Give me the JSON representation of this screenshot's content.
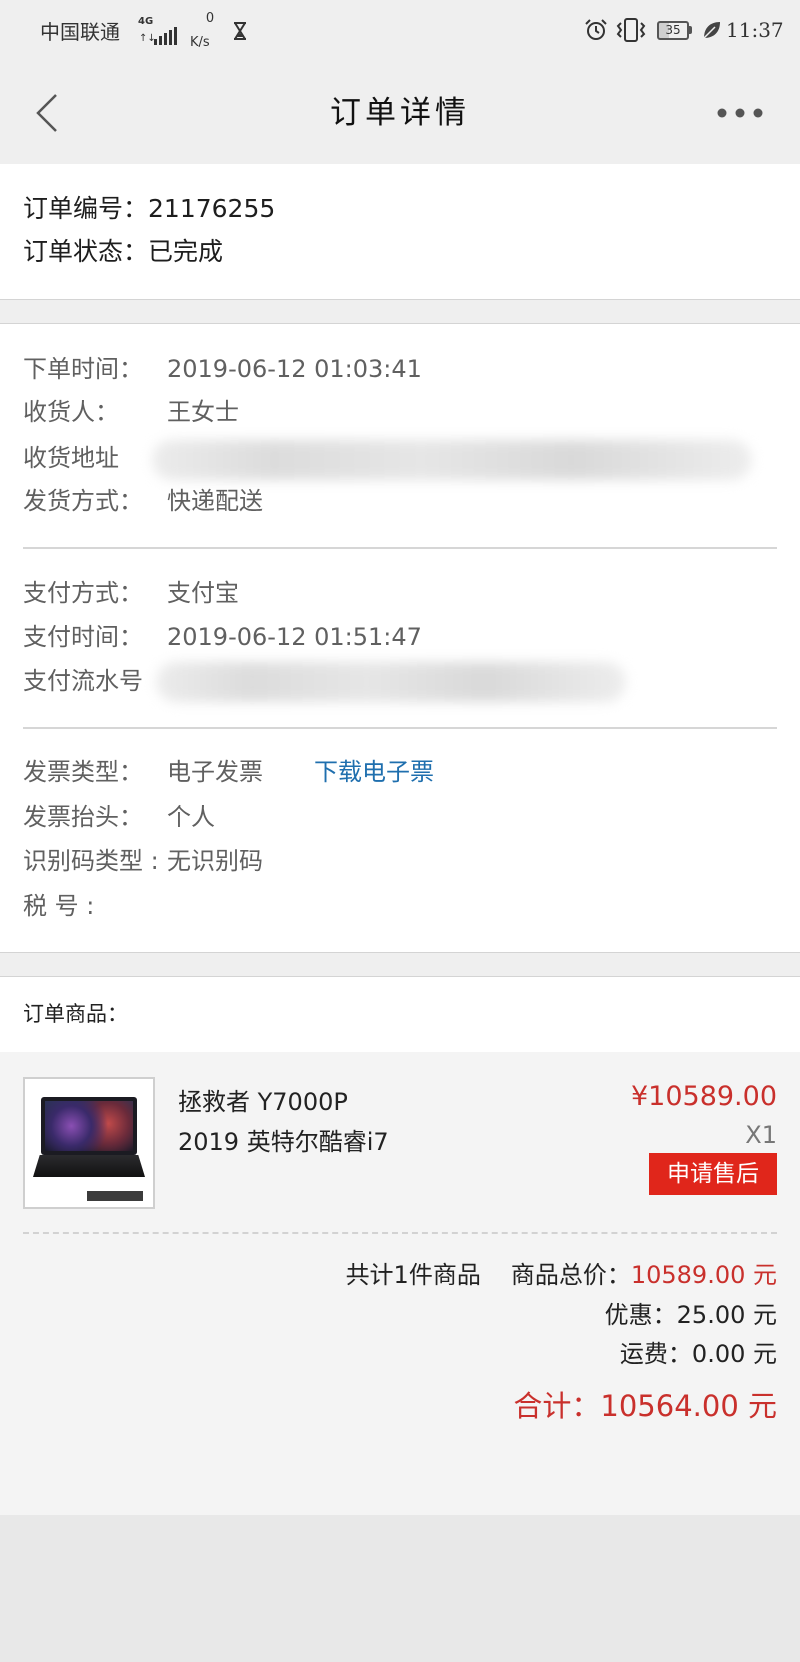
{
  "status_bar": {
    "carrier": "中国联通",
    "network": "4G",
    "speed_value": "0",
    "speed_unit": "K/s",
    "battery": "35",
    "time": "11:37",
    "icons": [
      "signal-icon",
      "hourglass-icon",
      "alarm-icon",
      "vibrate-icon",
      "battery-icon",
      "leaf-icon"
    ]
  },
  "header": {
    "title": "订单详情",
    "back_icon": "chevron-left-icon",
    "more_icon": "more-dots-icon"
  },
  "order": {
    "number_label": "订单编号：",
    "number": "21176255",
    "status_label": "订单状态：",
    "status": "已完成"
  },
  "shipping": {
    "order_time_label": "下单时间：",
    "order_time": "2019-06-12 01:03:41",
    "receiver_label": "收货人：",
    "receiver": "王女士",
    "address_label": "收货地址",
    "delivery_label": "发货方式：",
    "delivery": "快递配送"
  },
  "payment": {
    "method_label": "支付方式：",
    "method": "支付宝",
    "time_label": "支付时间：",
    "time": "2019-06-12 01:51:47",
    "serial_label": "支付流水号"
  },
  "invoice": {
    "type_label": "发票类型：",
    "type": "电子发票",
    "download_link": "下载电子票",
    "title_label": "发票抬头：",
    "title": "个人",
    "id_type_label": "识别码类型 :",
    "id_type": "无识别码",
    "tax_label": "税 号 :"
  },
  "goods": {
    "section_label": "订单商品：",
    "items": [
      {
        "name_line1": "拯救者 Y7000P",
        "name_line2": "2019 英特尔酷睿i7",
        "price": "¥10589.00",
        "quantity": "X1",
        "aftersale_button": "申请售后"
      }
    ]
  },
  "summary": {
    "count_text": "共计1件商品",
    "total_label": "商品总价：",
    "total": "10589.00 元",
    "discount_label": "优惠：",
    "discount": "25.00 元",
    "shipping_label": "运费：",
    "shipping": "0.00 元",
    "grand_label": "合计：",
    "grand_total": "10564.00 元"
  },
  "colors": {
    "accent_red": "#c9302c",
    "button_red": "#e0261b",
    "link_blue": "#1f6fae",
    "background_gray": "#efefef"
  }
}
